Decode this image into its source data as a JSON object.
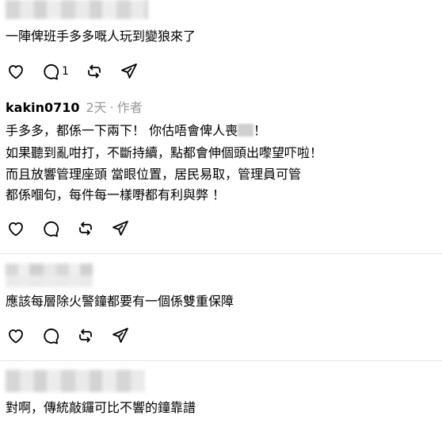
{
  "posts": [
    {
      "text": "一陣俾班手多多嘅人玩到變狼來了",
      "reply_count": "1"
    },
    {
      "username": "kakin0710",
      "time": "2天",
      "role": "作者",
      "lines": [
        "手多多，都係一下兩下！ ￼￼你估唔會俾人喪",
        "！",
        "￼￼如果聽到亂咁打，不斷持續，￼￼點都會伸個頭出嚟望吓啦！",
        "￼而且放響管理￼座頭 ￼當眼位置，￼￼居民易取，￼管理員可管",
        "￼都係嗰句，每件每一樣嘢都有利與弊 ！"
      ]
    },
    {
      "text": "應該每層除火警鐘都要有一個係雙重保障"
    },
    {
      "text": "對啊，傳統敲鑼可比不響的鐘靠譜"
    }
  ],
  "icons": {
    "like": "heart-icon",
    "reply": "comment-icon",
    "repost": "repost-icon",
    "share": "send-icon"
  }
}
